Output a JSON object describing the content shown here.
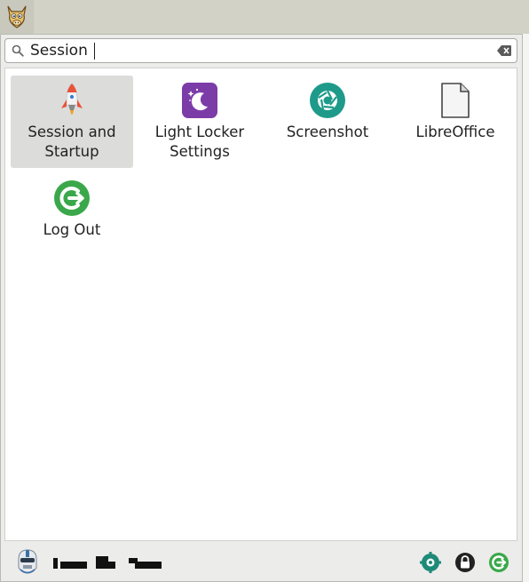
{
  "search": {
    "value": "Session",
    "icon": "search-icon",
    "clear_icon": "clear-icon"
  },
  "results": [
    {
      "label": "Session and\nStartup",
      "icon": "rocket-icon",
      "selected": true
    },
    {
      "label": "Light Locker\nSettings",
      "icon": "moon-icon",
      "color": "#7c3ca8"
    },
    {
      "label": "Screenshot",
      "icon": "aperture-icon",
      "color": "#1e9a8a"
    },
    {
      "label": "LibreOffice",
      "icon": "document-icon"
    },
    {
      "label": "Log Out",
      "icon": "logout-icon",
      "color": "#3aa84a"
    }
  ],
  "bottom": {
    "avatar_icon": "avatar-icon",
    "actions": [
      "settings-icon",
      "lock-icon",
      "logout-icon"
    ]
  },
  "colors": {
    "selected_tile": "#dcdcda",
    "panel": "#d2d2c6",
    "logout_green": "#3aa84a",
    "settings_teal": "#1e8a78"
  }
}
